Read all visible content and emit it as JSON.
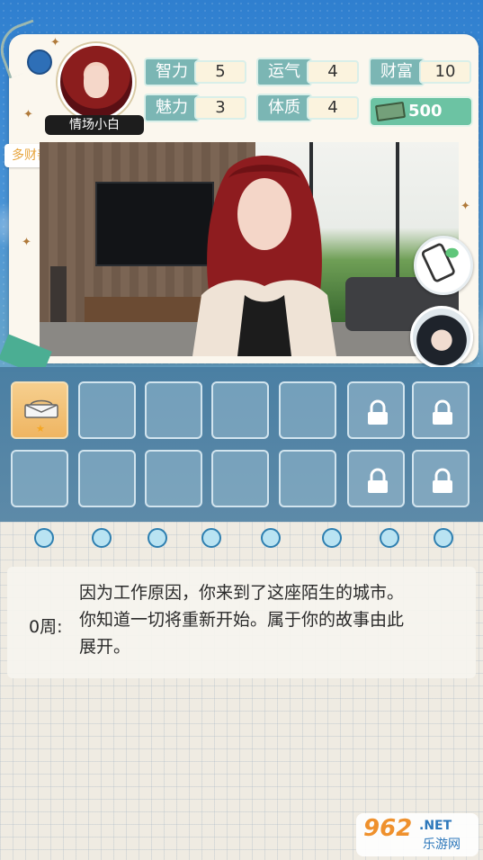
{
  "profile": {
    "name": "情场小白",
    "motto": "多财善贾"
  },
  "stats": [
    {
      "label": "智力",
      "value": "5"
    },
    {
      "label": "运气",
      "value": "4"
    },
    {
      "label": "财富",
      "value": "10"
    },
    {
      "label": "魅力",
      "value": "3"
    },
    {
      "label": "体质",
      "value": "4"
    }
  ],
  "money": "500",
  "inventory": {
    "row1": [
      "purse",
      "",
      "",
      "",
      "",
      "locked",
      "locked"
    ],
    "row2": [
      "",
      "",
      "",
      "",
      "",
      "locked",
      "locked"
    ]
  },
  "journal": {
    "week_label": "0周:",
    "lines": [
      "因为工作原因，你来到了这座陌生的城市。",
      "你知道一切将重新开始。属于你的故事由此",
      "展开。"
    ]
  },
  "watermark": {
    "brand": "962",
    "net": ".NET",
    "cn": "乐游网"
  },
  "colors": {
    "stat_tag": "#7bb6b4",
    "money": "#6cc3a3",
    "motto_text": "#e7a43c"
  }
}
